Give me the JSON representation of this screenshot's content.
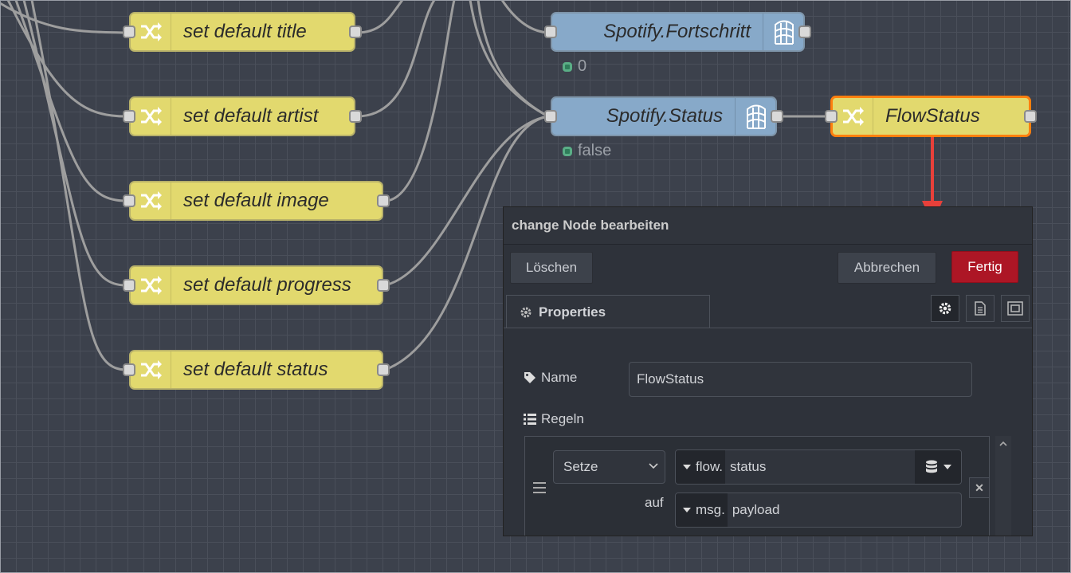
{
  "nodes": {
    "set_title": "set default title",
    "set_artist": "set default artist",
    "set_image": "set default image",
    "set_progress": "set default progress",
    "set_status": "set default status",
    "spotify_fortschritt": "Spotify.Fortschritt",
    "spotify_status": "Spotify.Status",
    "flowstatus": "FlowStatus"
  },
  "node_status": {
    "fortschritt": "0",
    "status": "false"
  },
  "panel": {
    "title": "change Node bearbeiten",
    "delete_label": "Löschen",
    "cancel_label": "Abbrechen",
    "done_label": "Fertig",
    "tab_label": "Properties",
    "name_label": "Name",
    "name_value": "FlowStatus",
    "rules_label": "Regeln",
    "rule": {
      "action": "Setze",
      "target_prefix": "flow.",
      "target_value": "status",
      "to_label": "auf",
      "source_prefix": "msg.",
      "source_value": "payload"
    }
  },
  "colors": {
    "change_node": "#e2d96e",
    "iobroker_node": "#87a9c9",
    "selected_border": "#ff7f0e",
    "done_button": "#ad1625",
    "annotation_arrow": "#e8403a"
  },
  "icons": {
    "change": "shuffle-icon",
    "iobroker": "iobroker-icon",
    "settings": "gear-icon",
    "description": "document-icon",
    "appearance": "frame-icon",
    "name": "tag-icon",
    "rules": "list-icon",
    "context_store": "database-icon"
  }
}
